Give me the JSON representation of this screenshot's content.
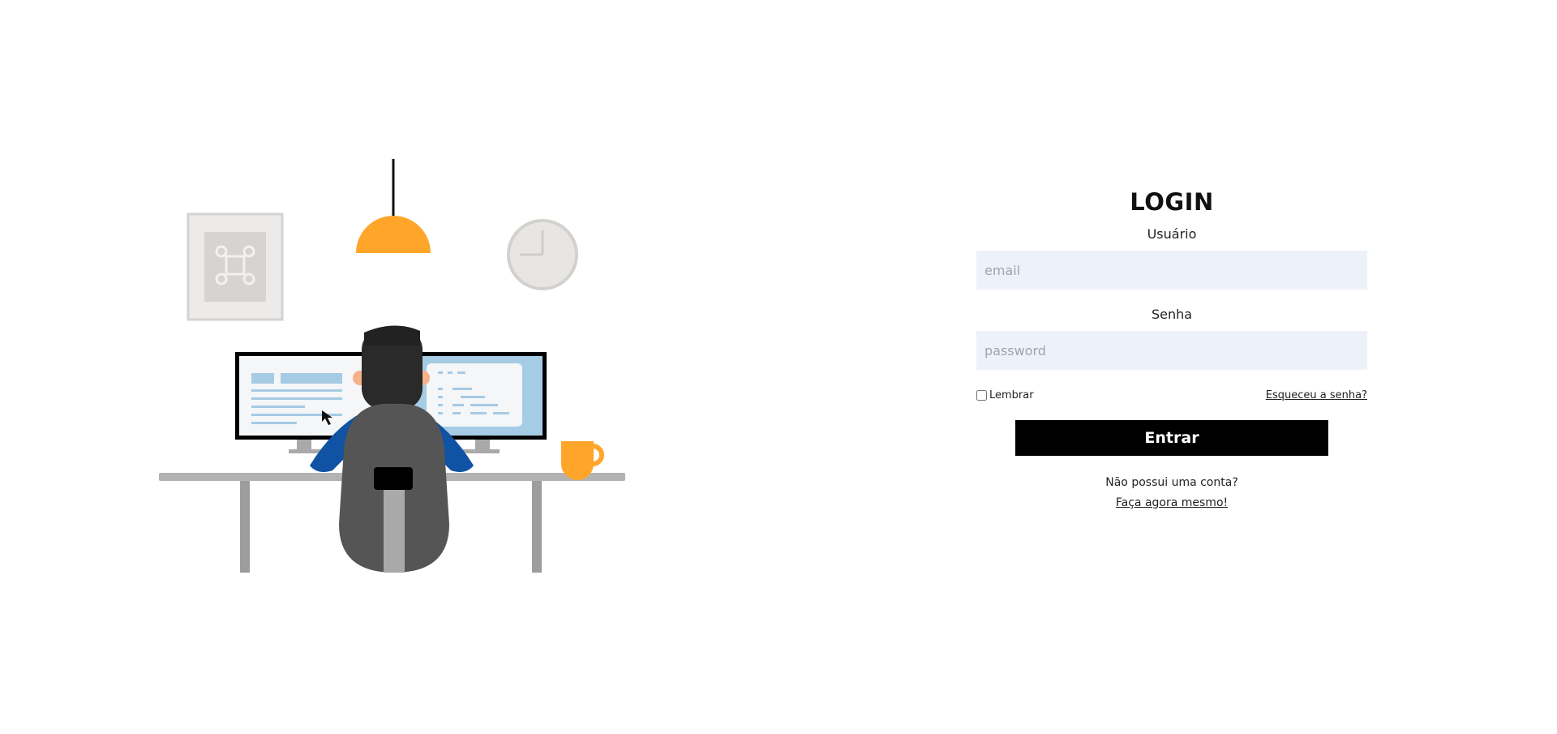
{
  "illustration": {
    "icon": "command-key-icon",
    "colors": {
      "lamp": "#ffa52a",
      "mug": "#ffa52a",
      "shirt": "#1052a3",
      "chair": "#555555",
      "hair": "#2a2a2a",
      "desk": "#b3b3b3",
      "screen": "#a6cbe4",
      "frame": "#ecebe9",
      "clock": "#e8e6e3"
    }
  },
  "login": {
    "title": "LOGIN",
    "username": {
      "label": "Usuário",
      "placeholder": "email",
      "value": ""
    },
    "password": {
      "label": "Senha",
      "placeholder": "password",
      "value": ""
    },
    "remember": {
      "label": "Lembrar",
      "checked": false
    },
    "forgot_link": "Esqueceu a senha?",
    "submit_label": "Entrar",
    "no_account_text": "Não possui uma conta?",
    "signup_link": "Faça agora mesmo!"
  },
  "colors": {
    "input_background": "#edf1f9",
    "button_background": "#000000",
    "button_text": "#ffffff"
  }
}
